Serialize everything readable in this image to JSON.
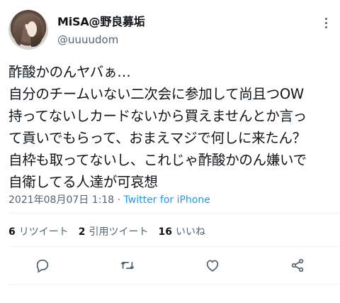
{
  "user": {
    "display_name": "MiSA@野良募垢",
    "handle": "@uuuudom"
  },
  "tweet": {
    "lines": [
      "酢酸かのんヤバぁ…",
      "自分のチームいない二次会に参加して尚且つOW",
      "持ってないしカードないから買えませんとか言っ",
      "て貢いでもらって、おまえマジで何しに来たん？",
      "自枠も取ってないし、これじゃ酢酸かのん嫌いで",
      "自衛してる人達が可哀想"
    ],
    "timestamp": "2021年08月07日 1:18",
    "separator": " · ",
    "source": "Twitter for iPhone"
  },
  "stats": {
    "retweets_count": "6",
    "retweets_label": "リツイート",
    "quotes_count": "2",
    "quotes_label": "引用ツイート",
    "likes_count": "16",
    "likes_label": "いいね"
  },
  "icons": {
    "reply": "reply-icon",
    "retweet": "retweet-icon",
    "like": "heart-icon",
    "share": "share-icon",
    "more": "more-icon"
  },
  "colors": {
    "text": "#0f1419",
    "secondary": "#536471",
    "link": "#1d9bf0",
    "divider": "#eff3f4"
  }
}
